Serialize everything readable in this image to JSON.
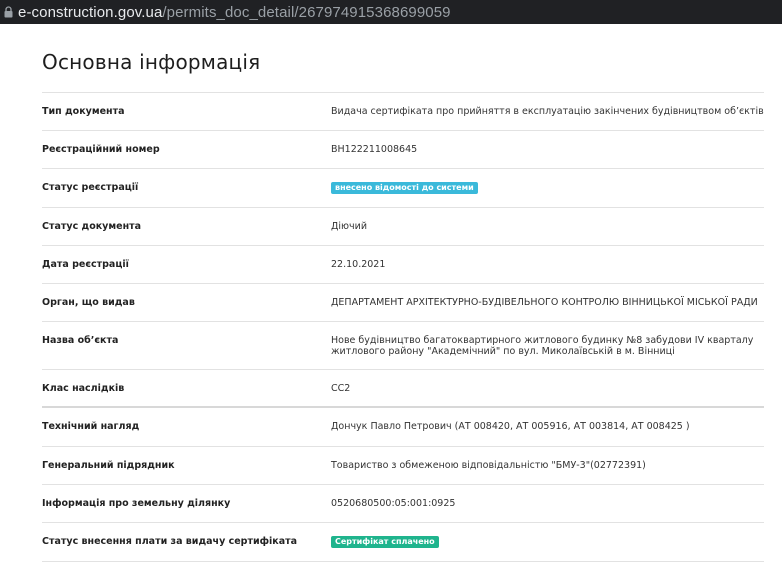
{
  "browser": {
    "url_domain": "e-construction.gov.ua",
    "url_path": "/permits_doc_detail/267974915368699059"
  },
  "page": {
    "title": "Основна інформація"
  },
  "rows": [
    {
      "label": "Тип документа",
      "value": "Видача сертифіката про прийняття в експлуатацію закінчених будівництвом об’єктів"
    },
    {
      "label": "Реєстраційний номер",
      "value": "ВН122211008645"
    },
    {
      "label": "Статус реєстрації",
      "value": "внесено відомості до системи",
      "badge_color": "#3ab9da"
    },
    {
      "label": "Статус документа",
      "value": "Діючий"
    },
    {
      "label": "Дата реєстрації",
      "value": "22.10.2021"
    },
    {
      "label": "Орган, що видав",
      "value": "ДЕПАРТАМЕНТ АРХІТЕКТУРНО-БУДІВЕЛЬНОГО КОНТРОЛЮ ВІННИЦЬКОЇ МІСЬКОЇ РАДИ"
    },
    {
      "label": "Назва об’єкта",
      "value": "Нове будівництво багатоквартирного житлового будинку №8 забудови IV кварталу житлового району \"Академічний\" по вул. Миколаївській в м. Вінниці"
    },
    {
      "label": "Клас наслідків",
      "value": "СС2"
    },
    {
      "label": "Технічний нагляд",
      "value": "Дончук Павло Петрович (АТ 008420, АТ 005916, АТ 003814, АТ 008425 )"
    },
    {
      "label": "Генеральний підрядник",
      "value": "Товариство з обмеженою відповідальністю \"БМУ-3\"(02772391)"
    },
    {
      "label": "Інформація про земельну ділянку",
      "value": "0520680500:05:001:0925"
    },
    {
      "label": "Статус внесення плати за видачу сертифіката",
      "value": "Сертифікат сплачено",
      "badge_color": "#1fb48d"
    }
  ]
}
